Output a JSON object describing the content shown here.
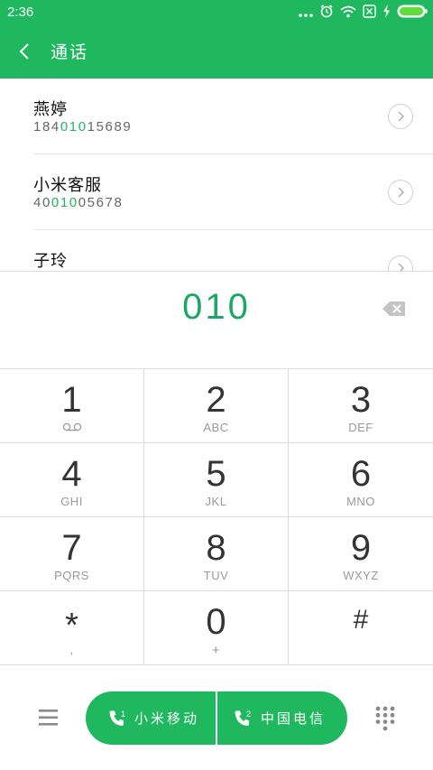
{
  "status": {
    "time": "2:36"
  },
  "header": {
    "title": "通话"
  },
  "results": [
    {
      "name": "燕婷",
      "number_pre": "184",
      "number_match": "010",
      "number_post": "15689"
    },
    {
      "name": "小米客服",
      "number_pre": "40",
      "number_match": "010",
      "number_post": "05678"
    },
    {
      "name": "子玲",
      "number_pre": "",
      "number_match": "",
      "number_post": ""
    }
  ],
  "input": {
    "value": "010"
  },
  "keypad": [
    {
      "digit": "1",
      "letters": ""
    },
    {
      "digit": "2",
      "letters": "ABC"
    },
    {
      "digit": "3",
      "letters": "DEF"
    },
    {
      "digit": "4",
      "letters": "GHI"
    },
    {
      "digit": "5",
      "letters": "JKL"
    },
    {
      "digit": "6",
      "letters": "MNO"
    },
    {
      "digit": "7",
      "letters": "PQRS"
    },
    {
      "digit": "8",
      "letters": "TUV"
    },
    {
      "digit": "9",
      "letters": "WXYZ"
    },
    {
      "digit": "*",
      "letters": ","
    },
    {
      "digit": "0",
      "letters": "+"
    },
    {
      "digit": "#",
      "letters": ""
    }
  ],
  "call": {
    "sim1_index": "1",
    "sim1_label": "小米移动",
    "sim2_index": "2",
    "sim2_label": "中国电信"
  },
  "icons": {
    "back": "chevron-left-icon",
    "voicemail": "voicemail-icon",
    "backspace": "backspace-icon",
    "menu": "menu-icon",
    "dialpad": "dialpad-grid-icon"
  },
  "colors": {
    "accent": "#1fb85f",
    "match": "#1aa866"
  }
}
